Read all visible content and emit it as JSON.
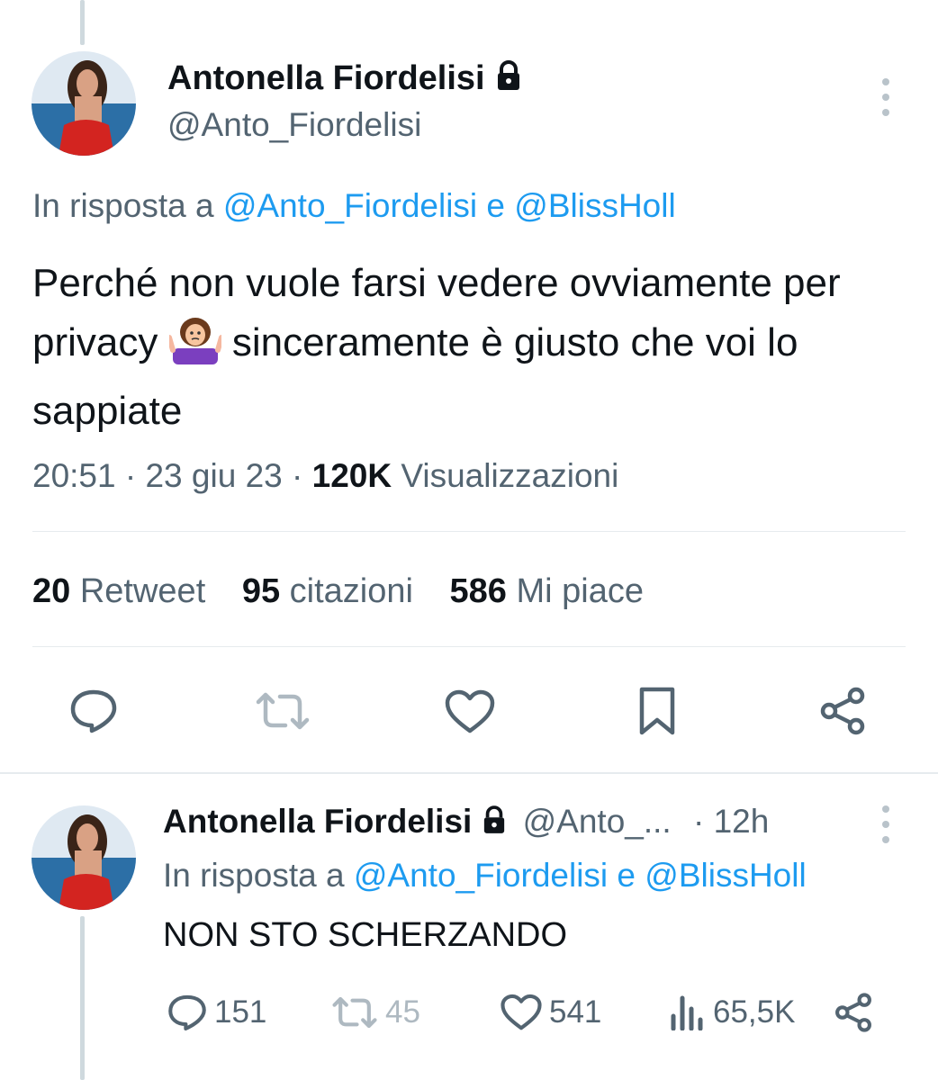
{
  "main_tweet": {
    "author_name": "Antonella Fiordelisi",
    "author_handle": "@Anto_Fiordelisi",
    "reply_prefix": "In risposta a",
    "reply_user_1": "@Anto_Fiordelisi",
    "reply_and": "e",
    "reply_user_2": "@BlissHoll",
    "text_before_emoji": "Perché non vuole farsi vedere ovviamente per privacy",
    "text_after_emoji": "sinceramente è giusto che voi lo sappiate",
    "time": "20:51",
    "date": "23 giu 23",
    "views_count": "120K",
    "views_label": "Visualizzazioni",
    "retweets_count": "20",
    "retweets_label": "Retweet",
    "quotes_count": "95",
    "quotes_label": "citazioni",
    "likes_count": "586",
    "likes_label": "Mi piace"
  },
  "reply_tweet": {
    "author_name": "Antonella Fiordelisi",
    "author_handle": "@Anto_...",
    "age": "· 12h",
    "reply_prefix": "In risposta a",
    "reply_user_1": "@Anto_Fiordelisi",
    "reply_and": "e",
    "reply_user_2": "@BlissHoll",
    "text": "NON STO SCHERZANDO",
    "reply_count": "151",
    "retweet_count": "45",
    "like_count": "541",
    "view_count": "65,5K"
  },
  "icons": [
    "lock-icon",
    "more-icon",
    "reply-icon",
    "retweet-icon",
    "like-icon",
    "bookmark-icon",
    "share-icon",
    "views-icon",
    "shrug-emoji-icon"
  ],
  "colors": {
    "link": "#1d9bf0",
    "muted": "#536471",
    "text": "#0f1419",
    "divider": "#e6ebee"
  }
}
